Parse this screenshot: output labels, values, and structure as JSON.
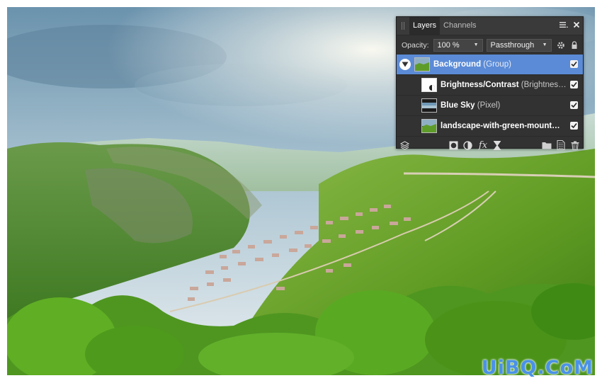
{
  "panel": {
    "tabs": [
      {
        "label": "Layers",
        "active": true
      },
      {
        "label": "Channels",
        "active": false
      }
    ],
    "menu_icon": "menu-lines-icon",
    "close_icon": "close-icon",
    "opacity_label": "Opacity:",
    "opacity_value": "100 %",
    "blend_mode": "Passthrough",
    "layers": [
      {
        "name": "Background",
        "type": "(Group)",
        "selected": true,
        "expandable": true,
        "visible": true,
        "thumb": "landscape"
      },
      {
        "name": "Brightness/Contrast",
        "type": "(Brightnes…",
        "selected": false,
        "expandable": false,
        "visible": true,
        "thumb": "adjustment"
      },
      {
        "name": "Blue Sky",
        "type": "(Pixel)",
        "selected": false,
        "expandable": false,
        "visible": true,
        "thumb": "sky"
      },
      {
        "name": "landscape-with-green-mount…",
        "type": "",
        "selected": false,
        "expandable": false,
        "visible": true,
        "thumb": "landscape"
      }
    ],
    "footer_icons": [
      "layer-stack-icon",
      "mask-icon",
      "adjustment-icon",
      "fx-icon",
      "hourglass-icon",
      "folder-icon",
      "new-layer-icon",
      "trash-icon"
    ]
  },
  "watermark": "UiBQ.CoM",
  "colors": {
    "panel_bg": "#323232",
    "selection": "#5b8bd6",
    "watermark": "#4a92e6"
  }
}
